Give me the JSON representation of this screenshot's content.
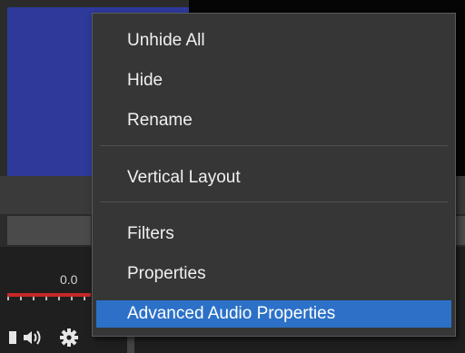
{
  "context_menu": {
    "groups": [
      [
        {
          "label": "Unhide All"
        },
        {
          "label": "Hide"
        },
        {
          "label": "Rename"
        }
      ],
      [
        {
          "label": "Vertical Layout"
        }
      ],
      [
        {
          "label": "Filters"
        },
        {
          "label": "Properties"
        },
        {
          "label": "Advanced Audio Properties",
          "highlighted": true
        }
      ]
    ]
  },
  "mixer": {
    "db_value": "0.0"
  },
  "colors": {
    "highlight": "#2c71c7",
    "menu_background": "#363636",
    "preview_blue": "#2e3a9a",
    "meter_red": "#c62828"
  }
}
